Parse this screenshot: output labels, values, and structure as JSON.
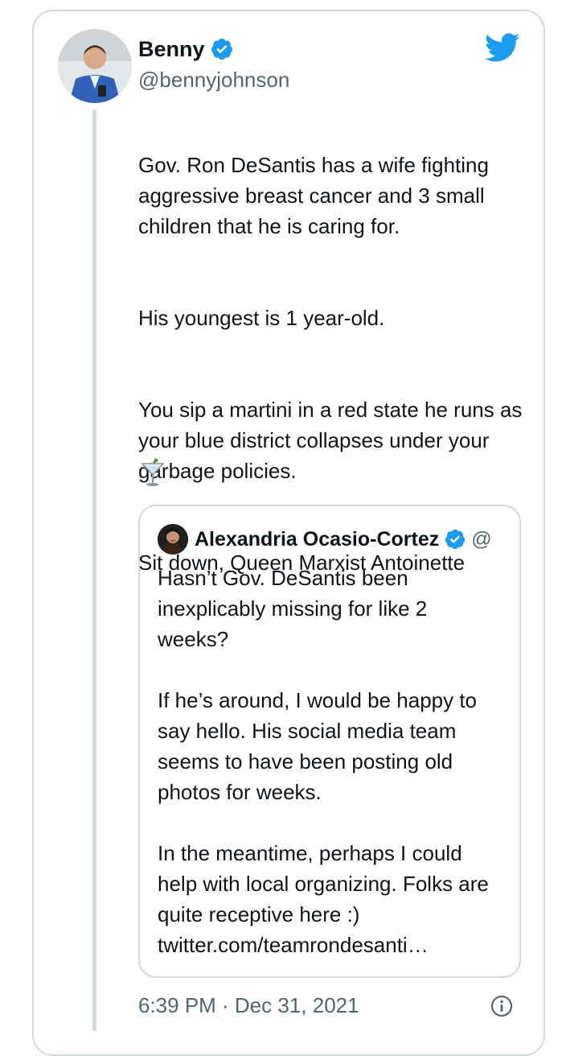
{
  "tweet": {
    "author_name": "Benny",
    "author_handle": "@bennyjohnson",
    "verified": true,
    "paragraphs": [
      "Gov. Ron DeSantis has a wife fighting aggressive breast cancer and 3 small children that he is caring for.",
      "His youngest is 1 year-old.",
      "You sip a martini in a red state he runs as your blue district collapses under your garbage policies.",
      "Sit down, Queen Marxist Antoinette"
    ],
    "emoji": "cocktail-glass-icon",
    "timestamp": "6:39 PM · Dec 31, 2021"
  },
  "quoted_tweet": {
    "author_name": "Alexandria Ocasio-Cortez",
    "author_handle_fragment": "@",
    "verified": true,
    "paragraphs": [
      "Hasn’t Gov. DeSantis been inexplicably missing for like 2 weeks?",
      "If he’s around, I would be happy to say hello. His social media team seems to have been posting old photos for weeks.",
      "In the meantime, perhaps I could help with local organizing. Folks are quite receptive here :)"
    ],
    "link": "twitter.com/teamrondesanti…"
  },
  "colors": {
    "accent": "#1d9bf0",
    "text": "#0f1419",
    "muted": "#536471",
    "border": "#cfd9de"
  }
}
